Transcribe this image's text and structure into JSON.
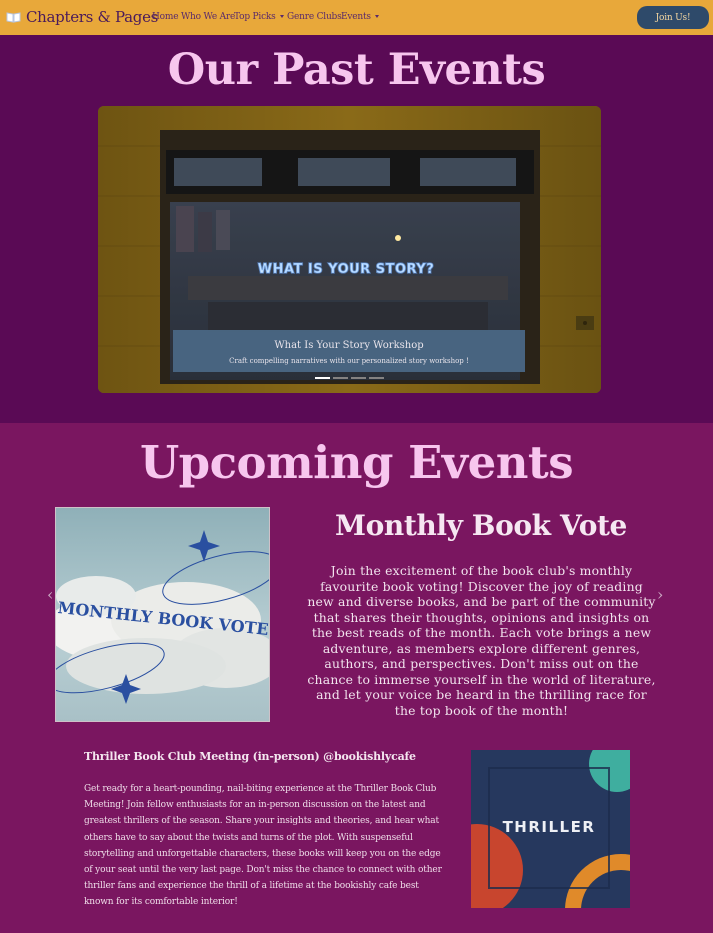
{
  "nav": {
    "brand": "Chapters & Pages",
    "links": [
      "Home",
      "Who We Are",
      "Top Picks",
      "Genre Clubs",
      "Events"
    ],
    "join_label": "Join Us!"
  },
  "past_events": {
    "title": "Our Past Events",
    "slide": {
      "sign_text": "WHAT IS YOUR STORY?",
      "caption_title": "What Is Your Story Workshop",
      "caption_text": "Craft compelling narratives with our personalized story workshop !"
    },
    "indicator_count": 4,
    "active_indicator": 1
  },
  "upcoming_events": {
    "title": "Upcoming Events",
    "vote": {
      "image_text": "MONTHLY BOOK VOTE",
      "heading": "Monthly Book Vote",
      "body": "Join the excitement of the book club's monthly favourite book voting! Discover the joy of reading new and diverse books, and be part of the community that shares their thoughts, opinions and insights on the best reads of the month. Each vote brings a new adventure, as members explore different genres, authors, and perspectives. Don't miss out on the chance to immerse yourself in the world of literature, and let your voice be heard in the thrilling race for the top book of the month!"
    },
    "thriller": {
      "heading": "Thriller Book Club Meeting (in-person) @bookishlycafe",
      "body": "Get ready for a heart-pounding, nail-biting experience at the Thriller Book Club Meeting! Join fellow enthusiasts for an in-person discussion on the latest and greatest thrillers of the season. Share your insights and theories, and hear what others have to say about the twists and turns of the plot. With suspenseful storytelling and unforgettable characters, these books will keep you on the edge of your seat until the very last page. Don't miss the chance to connect with other thriller fans and experience the thrill of a lifetime at the bookishly cafe best known for its comfortable interior!",
      "image_text": "THRILLER"
    }
  },
  "colors": {
    "navbar": "#e8a83a",
    "past_bg": "#5a0a55",
    "upcoming_bg": "#7a1660",
    "title_pink": "#f7c6ee",
    "button": "#2e4a6a"
  }
}
